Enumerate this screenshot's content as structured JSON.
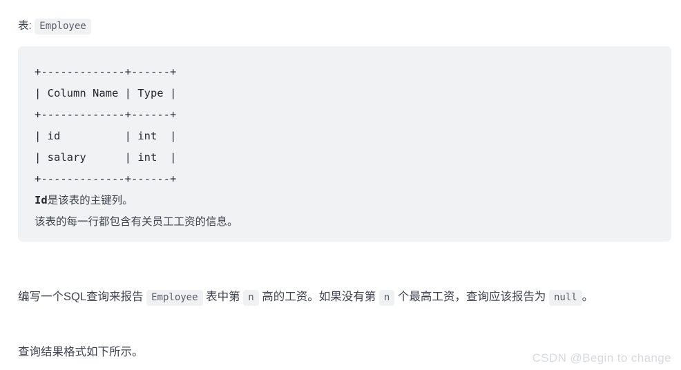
{
  "caption": {
    "label": "表:",
    "table_name": "Employee"
  },
  "code_block": {
    "background": "#f1f2f4",
    "lines": [
      "+-------------+------+",
      "| Column Name | Type |",
      "+-------------+------+",
      "| id          | int  |",
      "| salary      | int  |",
      "+-------------+------+"
    ],
    "schema": {
      "headers": [
        "Column Name",
        "Type"
      ],
      "rows": [
        [
          "id",
          "int"
        ],
        [
          "salary",
          "int"
        ]
      ]
    },
    "notes": [
      {
        "code_prefix": "Id",
        "text": "是该表的主键列。"
      },
      {
        "code_prefix": "",
        "text": "该表的每一行都包含有关员工工资的信息。"
      }
    ]
  },
  "paragraphs": {
    "main": {
      "part1": "编写一个SQL查询来报告 ",
      "code1": "Employee",
      "part2": " 表中第 ",
      "code2": "n",
      "part3": " 高的工资。如果没有第 ",
      "code3": "n",
      "part4": " 个最高工资，查询应该报告为 ",
      "code4": "null",
      "part5": "。"
    },
    "last": "查询结果格式如下所示。"
  },
  "watermark": {
    "text": "CSDN @Begin to change",
    "color": "#d8dade"
  }
}
